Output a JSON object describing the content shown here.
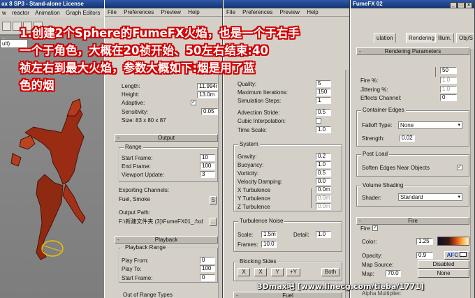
{
  "max": {
    "title": "ax 8 SP3 - Stand-alone License",
    "menu": [
      "w",
      "reactor",
      "Animation",
      "Graph Editors"
    ],
    "dropdown": "ult)"
  },
  "dialog1": {
    "menu": [
      "File",
      "Preferences",
      "Preview",
      "Help"
    ],
    "fields": {
      "length_label": "Length:",
      "length_value": "11.994m",
      "height_label": "Height:",
      "height_value": "13.0m",
      "adaptive_label": "Adaptive:",
      "sensitivity_label": "Sensitivity:",
      "sensitivity_value": "0.05",
      "size_label": "Size:",
      "size_value": "83 x 80 x 87"
    },
    "output_rollout": "Output",
    "range_group": "Range",
    "start_frame_label": "Start Frame:",
    "start_frame_value": "10",
    "end_frame_label": "End Frame:",
    "end_frame_value": "100",
    "viewport_update_label": "Viewport Update:",
    "viewport_update_value": "3",
    "exporting_label": "Exporting Channels:",
    "exporting_value": "Fuel, Smoke",
    "output_path_label": "Output Path:",
    "output_path_value": "F:\\新建文件夹 (3)\\FumeFX01_.fxd",
    "playback_rollout": "Playback",
    "playback_group": "Playback Range",
    "play_from_label": "Play From:",
    "play_from_value": "0",
    "play_to_label": "Play To:",
    "play_to_value": "100",
    "pb_start_label": "Start Frame:",
    "pb_start_value": "0",
    "outofrange_label": "Out of Range Types"
  },
  "dialog2": {
    "menu": [
      "File",
      "Preferences",
      "Preview",
      "Help"
    ],
    "quality_label": "Quality:",
    "quality_value": "5",
    "max_iter_label": "Maximum Iterations:",
    "max_iter_value": "150",
    "sim_steps_label": "Simulation Steps:",
    "sim_steps_value": "1",
    "adv_stride_label": "Advection Stride:",
    "adv_stride_value": "0.5",
    "cubic_label": "Cubic Interpolation:",
    "time_scale_label": "Time Scale:",
    "time_scale_value": "1.0",
    "system_group": "System",
    "gravity_label": "Gravity:",
    "gravity_value": "0.2",
    "buoyancy_label": "Buoyancy:",
    "buoyancy_value": "1.0",
    "vorticity_label": "Vorticity:",
    "vorticity_value": "0.5",
    "vel_damp_label": "Velocity Damping:",
    "vel_damp_value": "0.0",
    "xturb_label": "X Turbulence",
    "xturb_value": "0.0m",
    "yturb_label": "Y Turbulence",
    "yturb_value": "0.0m",
    "zturb_label": "Z Turbulence",
    "zturb_value": "0.0m",
    "turb_noise_group": "Turbulence Noise",
    "scale_label": "Scale:",
    "scale_value": "1.5m",
    "detail_label": "Detail:",
    "detail_value": "1.0",
    "frames_label": "Frames:",
    "frames_value": "10.0",
    "blocking_group": "Blocking Sides",
    "bx": "X",
    "bxp": "X",
    "by": "Y",
    "byp": "+Y",
    "both": "Both",
    "fuel_rollout": "Fuel"
  },
  "dialog3": {
    "title": "FumeFX 02",
    "tabs": [
      "ulation",
      "Rendering",
      "Illum.",
      "Obj/S"
    ],
    "rendering_params": "Rendering Parameters",
    "step_value": "50",
    "fire_pct_label": "Fire %:",
    "fire_pct_value": "1.0",
    "jitter_label": "Jittering %:",
    "jitter_value": "1.0",
    "effects_label": "Effects Channel:",
    "effects_value": "0",
    "container_group": "Container Edges",
    "falloff_label": "Falloff Type:",
    "falloff_value": "None",
    "strength_label": "Strength:",
    "strength_value": "0.02",
    "postload_group": "Post Load",
    "soften_label": "Soften Edges Near Objects",
    "volume_group": "Volume Shading",
    "shader_label": "Shader:",
    "shader_value": "Standard",
    "fire_rollout": "Fire",
    "fire_chk_label": "Fire",
    "color_label": "Color:",
    "color_value": "1.25",
    "opacity_label": "Opacity:",
    "opacity_value": "0.9",
    "afc_label": "AFC",
    "mapsource_label": "Map Source:",
    "mapsource_value": "Disabled",
    "map_label": "Map:",
    "map_value": "70.0",
    "map_none": "None",
    "alpha_label": "Alpha Multiplier:"
  },
  "overlay": {
    "caption_l1": "1.创建2个Sphere的FumeFX火焰，也是一个于右手",
    "caption_l2": "一个于角色，大概在20祯开始、50左右结束:40",
    "caption_l3": "祯左右到最大火焰，参数大概如下:烟是用了蓝",
    "caption_l4": "色的烟",
    "watermark": "3Dmax吧 [www.linecg.com/tieba/1771]"
  },
  "colors": {
    "overlay_text": "#ffffff",
    "overlay_stroke": "#d10000",
    "titlebar": "#2d58a8"
  }
}
